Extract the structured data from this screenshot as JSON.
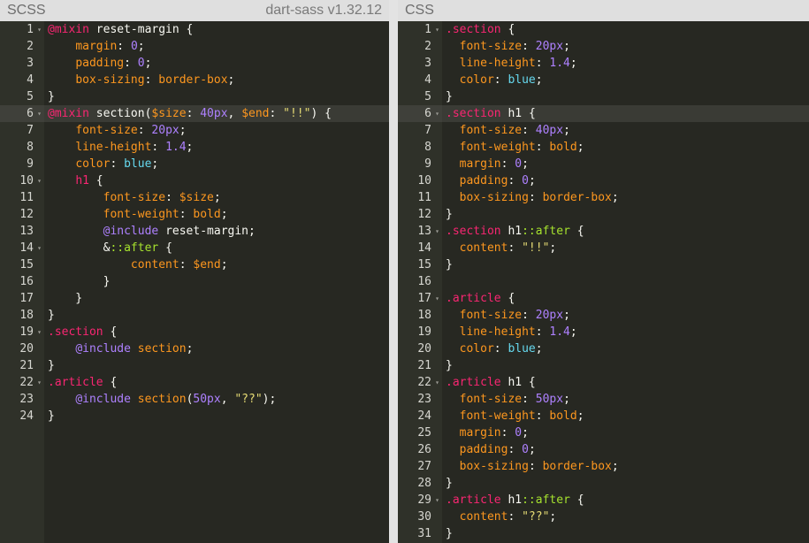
{
  "left_pane": {
    "title": "SCSS",
    "version": "dart-sass v1.32.12",
    "active_line": 6,
    "lines": [
      {
        "n": "1",
        "fold": true,
        "tokens": [
          [
            "at",
            "@mixin"
          ],
          [
            "kw",
            " reset-margin {"
          ]
        ]
      },
      {
        "n": "2",
        "tokens": [
          [
            "kw",
            "    "
          ],
          [
            "prop",
            "margin"
          ],
          [
            "kw",
            ": "
          ],
          [
            "num",
            "0"
          ],
          [
            "kw",
            ";"
          ]
        ]
      },
      {
        "n": "3",
        "tokens": [
          [
            "kw",
            "    "
          ],
          [
            "prop",
            "padding"
          ],
          [
            "kw",
            ": "
          ],
          [
            "num",
            "0"
          ],
          [
            "kw",
            ";"
          ]
        ]
      },
      {
        "n": "4",
        "tokens": [
          [
            "kw",
            "    "
          ],
          [
            "prop",
            "box-sizing"
          ],
          [
            "kw",
            ": "
          ],
          [
            "var",
            "border-box"
          ],
          [
            "kw",
            ";"
          ]
        ]
      },
      {
        "n": "5",
        "tokens": [
          [
            "kw",
            "}"
          ]
        ]
      },
      {
        "n": "6",
        "fold": true,
        "tokens": [
          [
            "at",
            "@mixin"
          ],
          [
            "kw",
            " section("
          ],
          [
            "var",
            "$size"
          ],
          [
            "kw",
            ": "
          ],
          [
            "num",
            "40px"
          ],
          [
            "kw",
            ", "
          ],
          [
            "var",
            "$end"
          ],
          [
            "kw",
            ": "
          ],
          [
            "str",
            "\"!!\""
          ],
          [
            "kw",
            ") {"
          ]
        ]
      },
      {
        "n": "7",
        "tokens": [
          [
            "kw",
            "    "
          ],
          [
            "prop",
            "font-size"
          ],
          [
            "kw",
            ": "
          ],
          [
            "num",
            "20px"
          ],
          [
            "kw",
            ";"
          ]
        ]
      },
      {
        "n": "8",
        "tokens": [
          [
            "kw",
            "    "
          ],
          [
            "prop",
            "line-height"
          ],
          [
            "kw",
            ": "
          ],
          [
            "num",
            "1.4"
          ],
          [
            "kw",
            ";"
          ]
        ]
      },
      {
        "n": "9",
        "tokens": [
          [
            "kw",
            "    "
          ],
          [
            "prop",
            "color"
          ],
          [
            "kw",
            ": "
          ],
          [
            "const",
            "blue"
          ],
          [
            "kw",
            ";"
          ]
        ]
      },
      {
        "n": "10",
        "fold": true,
        "tokens": [
          [
            "kw",
            "    "
          ],
          [
            "cls",
            "h1"
          ],
          [
            "kw",
            " {"
          ]
        ]
      },
      {
        "n": "11",
        "tokens": [
          [
            "kw",
            "        "
          ],
          [
            "prop",
            "font-size"
          ],
          [
            "kw",
            ": "
          ],
          [
            "var",
            "$size"
          ],
          [
            "kw",
            ";"
          ]
        ]
      },
      {
        "n": "12",
        "tokens": [
          [
            "kw",
            "        "
          ],
          [
            "prop",
            "font-weight"
          ],
          [
            "kw",
            ": "
          ],
          [
            "var",
            "bold"
          ],
          [
            "kw",
            ";"
          ]
        ]
      },
      {
        "n": "13",
        "tokens": [
          [
            "kw",
            "        "
          ],
          [
            "builtin",
            "@include"
          ],
          [
            "kw",
            " reset-margin;"
          ]
        ]
      },
      {
        "n": "14",
        "fold": true,
        "tokens": [
          [
            "kw",
            "        &"
          ],
          [
            "sel",
            "::after"
          ],
          [
            "kw",
            " {"
          ]
        ]
      },
      {
        "n": "15",
        "tokens": [
          [
            "kw",
            "            "
          ],
          [
            "prop",
            "content"
          ],
          [
            "kw",
            ": "
          ],
          [
            "var",
            "$end"
          ],
          [
            "kw",
            ";"
          ]
        ]
      },
      {
        "n": "16",
        "tokens": [
          [
            "kw",
            "        }"
          ]
        ]
      },
      {
        "n": "17",
        "tokens": [
          [
            "kw",
            "    }"
          ]
        ]
      },
      {
        "n": "18",
        "tokens": [
          [
            "kw",
            "}"
          ]
        ]
      },
      {
        "n": "19",
        "fold": true,
        "tokens": [
          [
            "cls",
            ".section"
          ],
          [
            "kw",
            " {"
          ]
        ]
      },
      {
        "n": "20",
        "tokens": [
          [
            "kw",
            "    "
          ],
          [
            "builtin",
            "@include"
          ],
          [
            "kw",
            " "
          ],
          [
            "var",
            "section"
          ],
          [
            "kw",
            ";"
          ]
        ]
      },
      {
        "n": "21",
        "tokens": [
          [
            "kw",
            "}"
          ]
        ]
      },
      {
        "n": "22",
        "fold": true,
        "tokens": [
          [
            "cls",
            ".article"
          ],
          [
            "kw",
            " {"
          ]
        ]
      },
      {
        "n": "23",
        "tokens": [
          [
            "kw",
            "    "
          ],
          [
            "builtin",
            "@include"
          ],
          [
            "kw",
            " "
          ],
          [
            "var",
            "section"
          ],
          [
            "kw",
            "("
          ],
          [
            "num",
            "50px"
          ],
          [
            "kw",
            ", "
          ],
          [
            "str",
            "\"??\""
          ],
          [
            "kw",
            ");"
          ]
        ]
      },
      {
        "n": "24",
        "tokens": [
          [
            "kw",
            "}"
          ]
        ]
      }
    ]
  },
  "right_pane": {
    "title": "CSS",
    "active_line": 6,
    "lines": [
      {
        "n": "1",
        "fold": true,
        "tokens": [
          [
            "cls",
            ".section"
          ],
          [
            "kw",
            " {"
          ]
        ]
      },
      {
        "n": "2",
        "tokens": [
          [
            "kw",
            "  "
          ],
          [
            "prop",
            "font-size"
          ],
          [
            "kw",
            ": "
          ],
          [
            "num",
            "20px"
          ],
          [
            "kw",
            ";"
          ]
        ]
      },
      {
        "n": "3",
        "tokens": [
          [
            "kw",
            "  "
          ],
          [
            "prop",
            "line-height"
          ],
          [
            "kw",
            ": "
          ],
          [
            "num",
            "1.4"
          ],
          [
            "kw",
            ";"
          ]
        ]
      },
      {
        "n": "4",
        "tokens": [
          [
            "kw",
            "  "
          ],
          [
            "prop",
            "color"
          ],
          [
            "kw",
            ": "
          ],
          [
            "const",
            "blue"
          ],
          [
            "kw",
            ";"
          ]
        ]
      },
      {
        "n": "5",
        "tokens": [
          [
            "kw",
            "}"
          ]
        ]
      },
      {
        "n": "6",
        "fold": true,
        "tokens": [
          [
            "cls",
            ".section"
          ],
          [
            "kw",
            " h1 "
          ],
          [
            "kw",
            "{"
          ]
        ]
      },
      {
        "n": "7",
        "tokens": [
          [
            "kw",
            "  "
          ],
          [
            "prop",
            "font-size"
          ],
          [
            "kw",
            ": "
          ],
          [
            "num",
            "40px"
          ],
          [
            "kw",
            ";"
          ]
        ]
      },
      {
        "n": "8",
        "tokens": [
          [
            "kw",
            "  "
          ],
          [
            "prop",
            "font-weight"
          ],
          [
            "kw",
            ": "
          ],
          [
            "var",
            "bold"
          ],
          [
            "kw",
            ";"
          ]
        ]
      },
      {
        "n": "9",
        "tokens": [
          [
            "kw",
            "  "
          ],
          [
            "prop",
            "margin"
          ],
          [
            "kw",
            ": "
          ],
          [
            "num",
            "0"
          ],
          [
            "kw",
            ";"
          ]
        ]
      },
      {
        "n": "10",
        "tokens": [
          [
            "kw",
            "  "
          ],
          [
            "prop",
            "padding"
          ],
          [
            "kw",
            ": "
          ],
          [
            "num",
            "0"
          ],
          [
            "kw",
            ";"
          ]
        ]
      },
      {
        "n": "11",
        "tokens": [
          [
            "kw",
            "  "
          ],
          [
            "prop",
            "box-sizing"
          ],
          [
            "kw",
            ": "
          ],
          [
            "var",
            "border-box"
          ],
          [
            "kw",
            ";"
          ]
        ]
      },
      {
        "n": "12",
        "tokens": [
          [
            "kw",
            "}"
          ]
        ]
      },
      {
        "n": "13",
        "fold": true,
        "tokens": [
          [
            "cls",
            ".section"
          ],
          [
            "kw",
            " h1"
          ],
          [
            "sel",
            "::after"
          ],
          [
            "kw",
            " {"
          ]
        ]
      },
      {
        "n": "14",
        "tokens": [
          [
            "kw",
            "  "
          ],
          [
            "prop",
            "content"
          ],
          [
            "kw",
            ": "
          ],
          [
            "str",
            "\"!!\""
          ],
          [
            "kw",
            ";"
          ]
        ]
      },
      {
        "n": "15",
        "tokens": [
          [
            "kw",
            "}"
          ]
        ]
      },
      {
        "n": "16",
        "tokens": []
      },
      {
        "n": "17",
        "fold": true,
        "tokens": [
          [
            "cls",
            ".article"
          ],
          [
            "kw",
            " {"
          ]
        ]
      },
      {
        "n": "18",
        "tokens": [
          [
            "kw",
            "  "
          ],
          [
            "prop",
            "font-size"
          ],
          [
            "kw",
            ": "
          ],
          [
            "num",
            "20px"
          ],
          [
            "kw",
            ";"
          ]
        ]
      },
      {
        "n": "19",
        "tokens": [
          [
            "kw",
            "  "
          ],
          [
            "prop",
            "line-height"
          ],
          [
            "kw",
            ": "
          ],
          [
            "num",
            "1.4"
          ],
          [
            "kw",
            ";"
          ]
        ]
      },
      {
        "n": "20",
        "tokens": [
          [
            "kw",
            "  "
          ],
          [
            "prop",
            "color"
          ],
          [
            "kw",
            ": "
          ],
          [
            "const",
            "blue"
          ],
          [
            "kw",
            ";"
          ]
        ]
      },
      {
        "n": "21",
        "tokens": [
          [
            "kw",
            "}"
          ]
        ]
      },
      {
        "n": "22",
        "fold": true,
        "tokens": [
          [
            "cls",
            ".article"
          ],
          [
            "kw",
            " h1 {"
          ]
        ]
      },
      {
        "n": "23",
        "tokens": [
          [
            "kw",
            "  "
          ],
          [
            "prop",
            "font-size"
          ],
          [
            "kw",
            ": "
          ],
          [
            "num",
            "50px"
          ],
          [
            "kw",
            ";"
          ]
        ]
      },
      {
        "n": "24",
        "tokens": [
          [
            "kw",
            "  "
          ],
          [
            "prop",
            "font-weight"
          ],
          [
            "kw",
            ": "
          ],
          [
            "var",
            "bold"
          ],
          [
            "kw",
            ";"
          ]
        ]
      },
      {
        "n": "25",
        "tokens": [
          [
            "kw",
            "  "
          ],
          [
            "prop",
            "margin"
          ],
          [
            "kw",
            ": "
          ],
          [
            "num",
            "0"
          ],
          [
            "kw",
            ";"
          ]
        ]
      },
      {
        "n": "26",
        "tokens": [
          [
            "kw",
            "  "
          ],
          [
            "prop",
            "padding"
          ],
          [
            "kw",
            ": "
          ],
          [
            "num",
            "0"
          ],
          [
            "kw",
            ";"
          ]
        ]
      },
      {
        "n": "27",
        "tokens": [
          [
            "kw",
            "  "
          ],
          [
            "prop",
            "box-sizing"
          ],
          [
            "kw",
            ": "
          ],
          [
            "var",
            "border-box"
          ],
          [
            "kw",
            ";"
          ]
        ]
      },
      {
        "n": "28",
        "tokens": [
          [
            "kw",
            "}"
          ]
        ]
      },
      {
        "n": "29",
        "fold": true,
        "tokens": [
          [
            "cls",
            ".article"
          ],
          [
            "kw",
            " h1"
          ],
          [
            "sel",
            "::after"
          ],
          [
            "kw",
            " {"
          ]
        ]
      },
      {
        "n": "30",
        "tokens": [
          [
            "kw",
            "  "
          ],
          [
            "prop",
            "content"
          ],
          [
            "kw",
            ": "
          ],
          [
            "str",
            "\"??\""
          ],
          [
            "kw",
            ";"
          ]
        ]
      },
      {
        "n": "31",
        "tokens": [
          [
            "kw",
            "}"
          ]
        ]
      }
    ]
  },
  "icons": {
    "fold": "chevron-down-icon"
  },
  "colors": {
    "editor_bg": "#272822",
    "gutter_bg": "#2f3129",
    "header_bg": "#dfdfdf",
    "active_line_bg": "#3a3b35"
  }
}
